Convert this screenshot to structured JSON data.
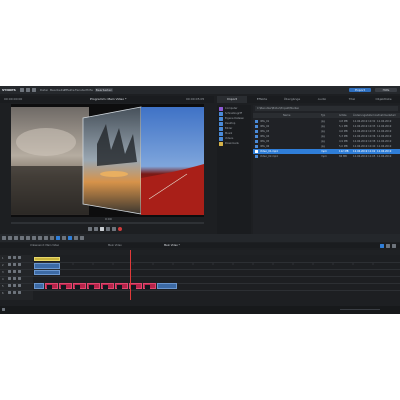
{
  "menu": {
    "logo": "SYNOPS",
    "items": [
      "Datei",
      "Bearbeiten",
      "Effekte",
      "Fenster",
      "Hilfe"
    ],
    "workspace": "Bearbeiten",
    "btn_left": "Export",
    "btn_right": "Hilfe"
  },
  "monitor": {
    "timecode_left": "00:00:00:00",
    "title": "Programm: Mein Video *",
    "timecode_right": "00:00:05:05",
    "bottom_label": "0:00"
  },
  "browser": {
    "tabs": [
      "Import",
      "Effekte",
      "Übergänge",
      "Audio",
      "Titel",
      "Objektliste"
    ],
    "path": "C:\\Benutzer\\Bilder\\Projekt\\Medien",
    "tree": [
      {
        "label": "Computer",
        "color": "#8e5ad6"
      },
      {
        "label": "Schnellzugriff",
        "color": "#4a8bd9"
      },
      {
        "label": "Eigene Dateien",
        "color": "#4a8bd9"
      },
      {
        "label": "Desktop",
        "color": "#4a8bd9"
      },
      {
        "label": "Bilder",
        "color": "#4a8bd9"
      },
      {
        "label": "Musik",
        "color": "#4a8bd9"
      },
      {
        "label": "Videos",
        "color": "#4a8bd9"
      },
      {
        "label": "Downloads",
        "color": "#d6b34a"
      }
    ],
    "columns": [
      "Name",
      "Typ",
      "Größe",
      "Änderungsdatum",
      "Aufnahmedatum"
    ],
    "files": [
      {
        "name": "IMG_01",
        "type": "jpg",
        "size": "4,8 MB",
        "modified": "12.06.2019 10:32",
        "taken": "12.06.2019"
      },
      {
        "name": "IMG_02",
        "type": "jpg",
        "size": "5,1 MB",
        "modified": "12.06.2019 10:33",
        "taken": "12.06.2019"
      },
      {
        "name": "IMG_03",
        "type": "jpg",
        "size": "4,6 MB",
        "modified": "12.06.2019 10:35",
        "taken": "12.06.2019"
      },
      {
        "name": "IMG_04",
        "type": "jpg",
        "size": "5,3 MB",
        "modified": "12.06.2019 10:36",
        "taken": "12.06.2019"
      },
      {
        "name": "IMG_05",
        "type": "jpg",
        "size": "4,9 MB",
        "modified": "12.06.2019 10:38",
        "taken": "12.06.2019"
      },
      {
        "name": "IMG_06",
        "type": "jpg",
        "size": "5,0 MB",
        "modified": "12.06.2019 10:40",
        "taken": "12.06.2019"
      },
      {
        "name": "Video_01.mp4",
        "type": "mp4",
        "size": "112 MB",
        "modified": "12.06.2019 11:02",
        "taken": "12.06.2019"
      },
      {
        "name": "Video_02.mp4",
        "type": "mp4",
        "size": "86 MB",
        "modified": "12.06.2019 11:05",
        "taken": "12.06.2019"
      }
    ],
    "selected_index": 6
  },
  "timeline": {
    "tabs": [
      "Unbenannt: Mein Video",
      "Mein Video",
      "Mein Video *"
    ],
    "track_labels": [
      "1",
      "2",
      "3",
      "4",
      "5",
      "6"
    ]
  },
  "colors": {
    "accent": "#2e6fbf",
    "selection": "#2f7ed8",
    "clip_pink": "#b7244a",
    "clip_yellow": "#c9b43c",
    "playhead": "#e03a3a"
  }
}
